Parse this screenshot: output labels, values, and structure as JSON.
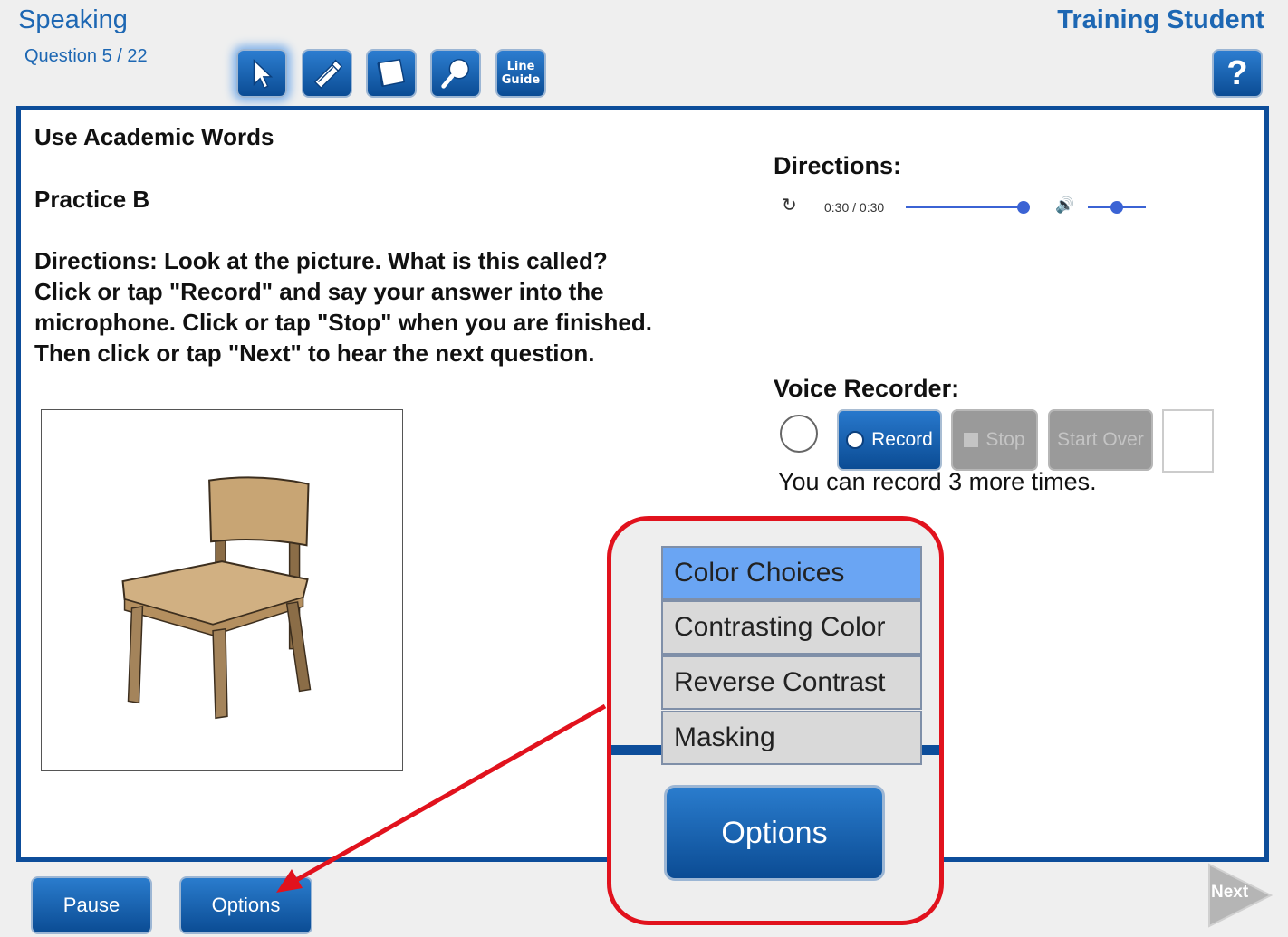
{
  "header": {
    "subject": "Speaking",
    "question_counter": "Question 5 / 22",
    "student_name": "Training Student",
    "help_label": "?"
  },
  "toolbar": {
    "tools": [
      "pointer-icon",
      "highlighter-icon",
      "notepad-icon",
      "magnifier-icon",
      "line-guide-icon"
    ],
    "line_guide_label_1": "Line",
    "line_guide_label_2": "Guide"
  },
  "question": {
    "title": "Use Academic Words",
    "subtitle": "Practice B",
    "directions_line_1": "Directions: Look at the picture. What is this called?",
    "directions_line_2": "Click or tap \"Record\" and say your answer into the",
    "directions_line_3": "microphone. Click or tap \"Stop\" when you are finished.",
    "directions_line_4": "Then click or tap \"Next\" to hear the next question."
  },
  "directions_audio": {
    "heading": "Directions:",
    "time": "0:30 / 0:30",
    "progress": 1.0,
    "volume": 0.5
  },
  "voice_recorder": {
    "heading": "Voice Recorder:",
    "record_label": "Record",
    "stop_label": "Stop",
    "start_over_label": "Start Over",
    "remaining_text": "You can record 3 more times."
  },
  "footer": {
    "pause_label": "Pause",
    "options_label": "Options",
    "next_label": "Next"
  },
  "callout": {
    "menu_items": [
      "Color Choices",
      "Contrasting Color",
      "Reverse Contrast",
      "Masking"
    ],
    "options_label": "Options",
    "border_color": "#e1121d"
  },
  "colors": {
    "brand_blue": "#1d67b3",
    "frame_blue": "#0d4d9a",
    "highlight_blue": "#6aa5f3"
  }
}
